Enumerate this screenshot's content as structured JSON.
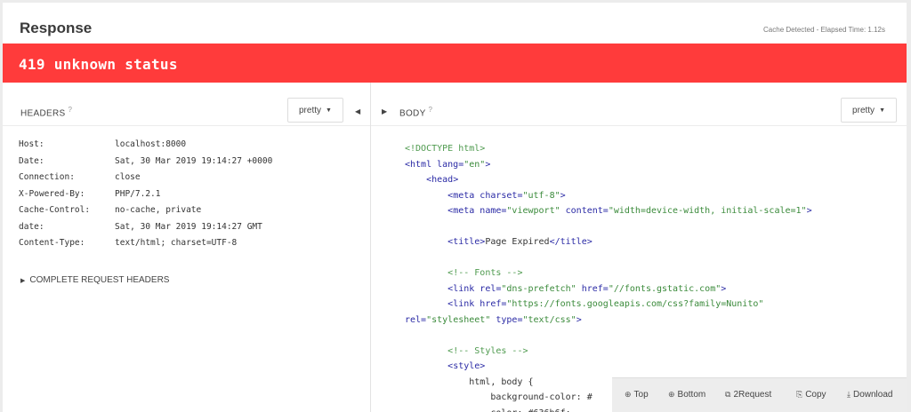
{
  "response": {
    "title": "Response",
    "cache_info": "Cache Detected - Elapsed Time: 1.12s",
    "status": "419 unknown status"
  },
  "headers": {
    "label": "HEADERS",
    "help": "?",
    "format": "pretty",
    "rows": [
      {
        "key": "Host:",
        "value": "localhost:8000"
      },
      {
        "key": "Date:",
        "value": "Sat, 30 Mar 2019 19:14:27 +0000"
      },
      {
        "key": "Connection:",
        "value": "close"
      },
      {
        "key": "X-Powered-By:",
        "value": "PHP/7.2.1"
      },
      {
        "key": "Cache-Control:",
        "value": "no-cache, private"
      },
      {
        "key": "date:",
        "value": "Sat, 30 Mar 2019 19:14:27 GMT"
      },
      {
        "key": "Content-Type:",
        "value": "text/html; charset=UTF-8"
      }
    ],
    "complete_request": "COMPLETE REQUEST HEADERS"
  },
  "body": {
    "label": "BODY",
    "help": "?",
    "format": "pretty",
    "lines": [
      {
        "indent": "",
        "parts": [
          {
            "t": "c-comment",
            "v": "<!DOCTYPE html>"
          }
        ]
      },
      {
        "indent": "",
        "parts": [
          {
            "t": "c-tag",
            "v": "<html "
          },
          {
            "t": "c-attr",
            "v": "lang="
          },
          {
            "t": "c-val",
            "v": "\"en\""
          },
          {
            "t": "c-tag",
            "v": ">"
          }
        ]
      },
      {
        "indent": "    ",
        "parts": [
          {
            "t": "c-tag",
            "v": "<head>"
          }
        ]
      },
      {
        "indent": "        ",
        "parts": [
          {
            "t": "c-tag",
            "v": "<meta "
          },
          {
            "t": "c-attr",
            "v": "charset="
          },
          {
            "t": "c-val",
            "v": "\"utf-8\""
          },
          {
            "t": "c-tag",
            "v": ">"
          }
        ]
      },
      {
        "indent": "        ",
        "parts": [
          {
            "t": "c-tag",
            "v": "<meta "
          },
          {
            "t": "c-attr",
            "v": "name="
          },
          {
            "t": "c-val",
            "v": "\"viewport\""
          },
          {
            "t": "c-attr",
            "v": " content="
          },
          {
            "t": "c-val",
            "v": "\"width=device-width, initial-scale=1\""
          },
          {
            "t": "c-tag",
            "v": ">"
          }
        ]
      },
      {
        "indent": "",
        "parts": []
      },
      {
        "indent": "        ",
        "parts": [
          {
            "t": "c-tag",
            "v": "<title>"
          },
          {
            "t": "c-text",
            "v": "Page Expired"
          },
          {
            "t": "c-tag",
            "v": "</title>"
          }
        ]
      },
      {
        "indent": "",
        "parts": []
      },
      {
        "indent": "        ",
        "parts": [
          {
            "t": "c-comment",
            "v": "<!-- Fonts -->"
          }
        ]
      },
      {
        "indent": "        ",
        "parts": [
          {
            "t": "c-tag",
            "v": "<link "
          },
          {
            "t": "c-attr",
            "v": "rel="
          },
          {
            "t": "c-val",
            "v": "\"dns-prefetch\""
          },
          {
            "t": "c-attr",
            "v": " href="
          },
          {
            "t": "c-val",
            "v": "\"//fonts.gstatic.com\""
          },
          {
            "t": "c-tag",
            "v": ">"
          }
        ]
      },
      {
        "indent": "        ",
        "parts": [
          {
            "t": "c-tag",
            "v": "<link "
          },
          {
            "t": "c-attr",
            "v": "href="
          },
          {
            "t": "c-val",
            "v": "\"https://fonts.googleapis.com/css?family=Nunito\""
          }
        ]
      },
      {
        "indent": "",
        "parts": [
          {
            "t": "c-attr",
            "v": "rel="
          },
          {
            "t": "c-val",
            "v": "\"stylesheet\""
          },
          {
            "t": "c-attr",
            "v": " type="
          },
          {
            "t": "c-val",
            "v": "\"text/css\""
          },
          {
            "t": "c-tag",
            "v": ">"
          }
        ]
      },
      {
        "indent": "",
        "parts": []
      },
      {
        "indent": "        ",
        "parts": [
          {
            "t": "c-comment",
            "v": "<!-- Styles -->"
          }
        ]
      },
      {
        "indent": "        ",
        "parts": [
          {
            "t": "c-tag",
            "v": "<style>"
          }
        ]
      },
      {
        "indent": "            ",
        "parts": [
          {
            "t": "c-text",
            "v": "html, body {"
          }
        ]
      },
      {
        "indent": "                ",
        "parts": [
          {
            "t": "c-text",
            "v": "background-color: #"
          }
        ]
      },
      {
        "indent": "                ",
        "parts": [
          {
            "t": "c-text",
            "v": "color: #636b6f;"
          }
        ]
      }
    ]
  },
  "toolbar": {
    "top": "Top",
    "bottom": "Bottom",
    "request": "2Request",
    "copy": "Copy",
    "download": "Download",
    "top_icon": "arrow-up-circle-icon",
    "bottom_icon": "arrow-down-circle-icon",
    "request_icon": "request-icon",
    "copy_icon": "copy-icon",
    "download_icon": "download-icon"
  },
  "colors": {
    "status_bar": "#ff3b3b",
    "tag": "#2a2aa5",
    "value": "#3a8a3a",
    "comment": "#4e9a4e"
  }
}
